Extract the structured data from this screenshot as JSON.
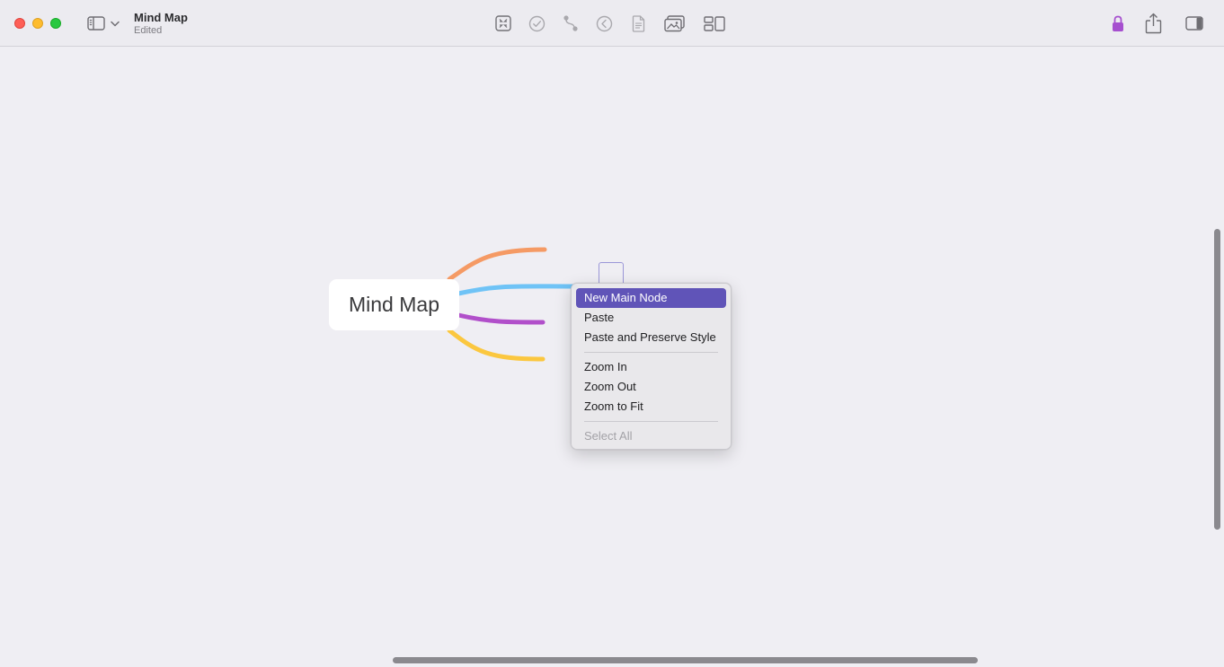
{
  "window": {
    "title": "Mind Map",
    "subtitle": "Edited"
  },
  "toolbar": {
    "icons": [
      "sidebar-icon",
      "chevron-down-icon",
      "focus-icon",
      "checkmark-icon",
      "connection-icon",
      "back-icon",
      "document-icon",
      "image-icon",
      "layout-icon",
      "lock-icon",
      "share-icon",
      "inspector-icon"
    ],
    "accent": "#a64fcf"
  },
  "canvas": {
    "main_node": {
      "label": "Mind Map"
    },
    "branch_colors": [
      "#f59a64",
      "#6fc3f6",
      "#b14fca",
      "#fbc73f"
    ]
  },
  "context_menu": {
    "highlight_color": "#6054b8",
    "items": [
      {
        "label": "New Main Node"
      },
      {
        "label": "Paste"
      },
      {
        "label": "Paste and Preserve Style"
      },
      {
        "label": "Zoom In"
      },
      {
        "label": "Zoom Out"
      },
      {
        "label": "Zoom to Fit"
      },
      {
        "label": "Select All"
      }
    ]
  }
}
